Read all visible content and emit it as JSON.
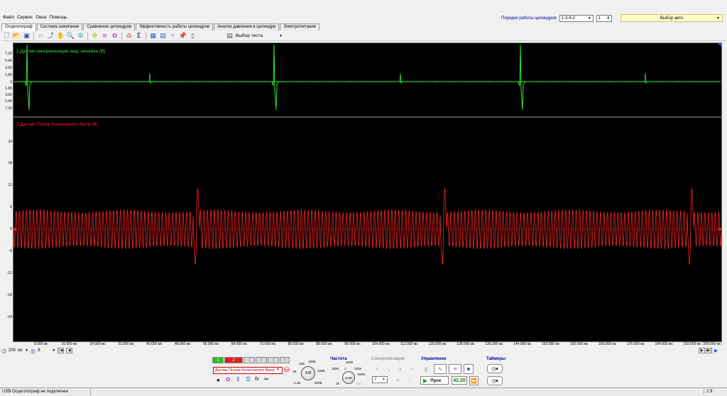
{
  "menu": [
    "Файл",
    "Сервис",
    "Окна",
    "Помощь"
  ],
  "top_right": {
    "order_label": "Порядок работы цилиндров",
    "order_value": "1-3-4-2",
    "cylinder_value": "1",
    "auto_label": "Выбор авто"
  },
  "tabs": [
    "Осциллограф",
    "Система зажигания",
    "Сравнение цилиндров",
    "Эффективность работы цилиндров",
    "Анализ давления в цилиндре",
    "Электропитание"
  ],
  "toolbar": {
    "test_select_label": "Выбор теста",
    "icons": [
      "new-file-icon",
      "open-folder-icon",
      "save-icon",
      "probe-icon",
      "cursor-icon",
      "hand-icon",
      "zoom-icon",
      "filter-icon",
      "grid-icon",
      "wave-icon",
      "color-icon",
      "measure-icon",
      "sigma-icon",
      "table-icon",
      "split-icon",
      "pin-icon",
      "page-icon"
    ]
  },
  "channels": [
    {
      "label": "1.Датчик синхронизации инд. линейка (В)",
      "color": "#2ee62e",
      "ticks": [
        "7.20",
        "5.40",
        "3.60",
        "1.80",
        "0",
        "1.80",
        "3.60",
        "5.40",
        "7.20"
      ]
    },
    {
      "label": "2.Датчик Полож Коленчатого Вала (В)",
      "color": "#ff2020",
      "ticks": [
        "24",
        "18",
        "12",
        "6",
        "0",
        "-6",
        "-12",
        "-18",
        "-24"
      ]
    }
  ],
  "x_ticks": [
    "8.000 мс",
    "16.000 мс",
    "24.000 мс",
    "32.000 мс",
    "40.000 мс",
    "48.000 мс",
    "56.000 мс",
    "64.000 мс",
    "72.000 мс",
    "80.000 мс",
    "88.000 мс",
    "96.000 мс",
    "104.000 мс",
    "112.000 мс",
    "120.000 мс",
    "128.000 мс",
    "136.000 мс",
    "144.000 мс",
    "152.000 мс",
    "160.000 мс",
    "168.000 мс",
    "176.000 мс",
    "184.000 мс",
    "192.000 мс",
    "200.000 мс"
  ],
  "timebar": {
    "time_value": "200",
    "time_unit": "мс",
    "count_value": "8"
  },
  "panel": {
    "channel_buttons": [
      "1",
      "2",
      "3",
      "4",
      "5",
      "6",
      "7",
      "8"
    ],
    "sensor_select": "Датчик Полож Коленчатого Вала",
    "voltage_knob": {
      "center": "30В",
      "labels": [
        "10В",
        "100В",
        "200В",
        "500В",
        "0.1В",
        "1В"
      ]
    },
    "freq_title": "Частота",
    "freq_knob": {
      "center": "333К",
      "labels": [
        "200К",
        "100К",
        "1",
        "333К",
        "500К",
        "1К",
        "1М"
      ]
    },
    "sync_title": "Синхронизация",
    "sync_value": "2",
    "control_title": "Управление",
    "start_label": "Пуск",
    "time_value": "42.20",
    "timers_title": "Таймеры"
  },
  "status": {
    "left": "USB Осциллограф не подключен",
    "right": "2.9"
  }
}
